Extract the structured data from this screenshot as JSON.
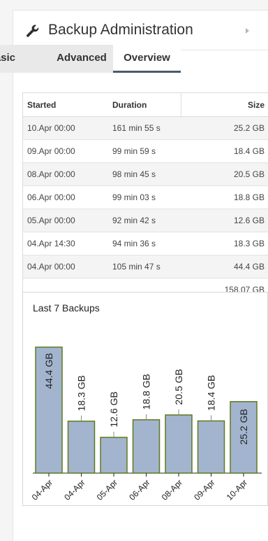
{
  "header": {
    "title": "Backup Administration",
    "icon": "wrench-icon",
    "chevron": "chevron-right-icon"
  },
  "tabs": [
    {
      "label": "Basic",
      "active": false
    },
    {
      "label": "Advanced",
      "active": false
    },
    {
      "label": "Overview",
      "active": true
    }
  ],
  "table": {
    "headers": [
      "Started",
      "Duration",
      "Size"
    ],
    "rows": [
      {
        "started": "10.Apr 00:00",
        "duration": "161 min 55 s",
        "size": "25.2 GB"
      },
      {
        "started": "09.Apr 00:00",
        "duration": "99 min 59 s",
        "size": "18.4 GB"
      },
      {
        "started": "08.Apr 00:00",
        "duration": "98 min 45 s",
        "size": "20.5 GB"
      },
      {
        "started": "06.Apr 00:00",
        "duration": "99 min 03 s",
        "size": "18.8 GB"
      },
      {
        "started": "05.Apr 00:00",
        "duration": "92 min 42 s",
        "size": "12.6 GB"
      },
      {
        "started": "04.Apr 14:30",
        "duration": "94 min 36 s",
        "size": "18.3 GB"
      },
      {
        "started": "04.Apr 00:00",
        "duration": "105 min 47 s",
        "size": "44.4 GB"
      }
    ],
    "total": "158.07 GB"
  },
  "colors": {
    "bar_fill": "#a3b4cf",
    "bar_stroke": "#5d7a1e",
    "tab_underline": "#4a5a6a"
  },
  "chart_data": {
    "type": "bar",
    "title": "Last 7 Backups",
    "categories": [
      "04-Apr",
      "04-Apr",
      "05-Apr",
      "06-Apr",
      "08-Apr",
      "09-Apr",
      "10-Apr"
    ],
    "values": [
      44.4,
      18.3,
      12.6,
      18.8,
      20.5,
      18.4,
      25.2
    ],
    "value_labels": [
      "44.4 GB",
      "18.3 GB",
      "12.6 GB",
      "18.8 GB",
      "20.5 GB",
      "18.4 GB",
      "25.2 GB"
    ],
    "ylim": [
      0,
      44.4
    ],
    "grid": false
  }
}
